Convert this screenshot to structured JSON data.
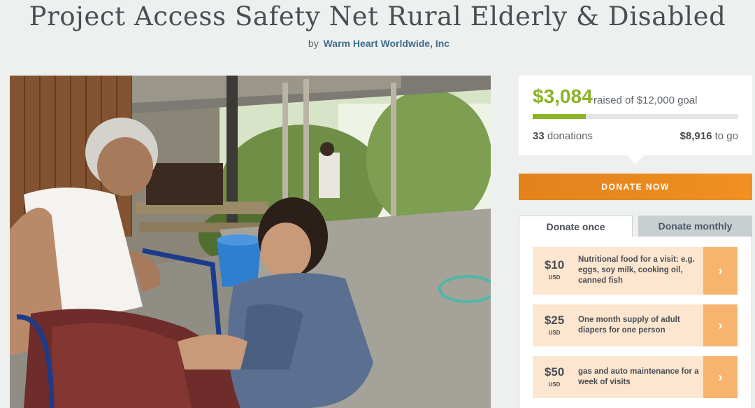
{
  "project": {
    "title": "Project Access Safety Net Rural Elderly & Disabled",
    "by_prefix": "by",
    "organization": "Warm Heart Worldwide, Inc"
  },
  "stats": {
    "raised": "$3,084",
    "raised_suffix": "raised of $12,000 goal",
    "progress_fraction": 0.257,
    "donations_count": "33",
    "donations_label": "donations",
    "to_go_amount": "$8,916",
    "to_go_label": "to go"
  },
  "actions": {
    "donate_now": "DONATE NOW"
  },
  "tabs": [
    {
      "label": "Donate once",
      "active": true
    },
    {
      "label": "Donate monthly",
      "active": false
    }
  ],
  "options": [
    {
      "amount": "$10",
      "currency": "USD",
      "description": "Nutritional food for a visit: e.g. eggs, soy milk, cooking oil, canned fish"
    },
    {
      "amount": "$25",
      "currency": "USD",
      "description": "One month supply of adult diapers for one person"
    },
    {
      "amount": "$50",
      "currency": "USD",
      "description": "gas and auto maintenance for a week of visits"
    }
  ],
  "icons": {
    "option_arrow": "chevron-right-icon"
  },
  "colors": {
    "accent_green": "#8cb327",
    "donate_orange": "#e98a1f",
    "option_bg": "#fde6cf",
    "option_arrow_bg": "#f7b46e",
    "link_blue": "#3f6e8c"
  }
}
